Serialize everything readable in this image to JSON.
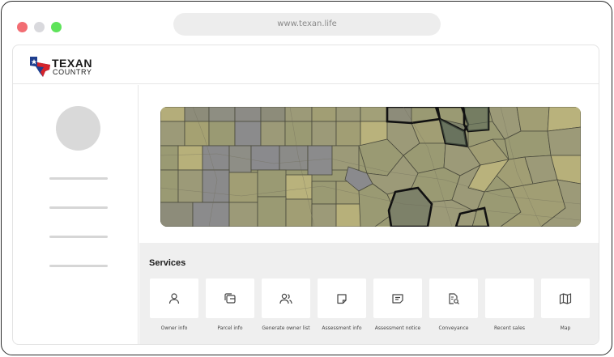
{
  "browser": {
    "url": "www.texan.life",
    "controls": {
      "close_color": "#f26d73",
      "minimize_color": "#d9d9dd",
      "maximize_color": "#5ee35a"
    }
  },
  "brand": {
    "line1": "TEXAN",
    "line2": "COUNTRY",
    "colors": {
      "blue": "#1f3f8f",
      "red": "#d4242b"
    }
  },
  "sidebar": {
    "avatar": "avatar-placeholder",
    "nav_items": 4
  },
  "map": {
    "subject": "county parcel map",
    "accent": "#9a9a73"
  },
  "services": {
    "title": "Services",
    "items": [
      {
        "label": "Owner info",
        "icon": "user-icon"
      },
      {
        "label": "Parcel info",
        "icon": "stacked-pages-icon"
      },
      {
        "label": "Generate owner list",
        "icon": "users-icon"
      },
      {
        "label": "Assessment info",
        "icon": "document-icon"
      },
      {
        "label": "Assessment notice",
        "icon": "notice-icon"
      },
      {
        "label": "Conveyance",
        "icon": "document-search-icon"
      },
      {
        "label": "Recent sales",
        "icon": ""
      },
      {
        "label": "Map",
        "icon": "map-icon"
      }
    ]
  }
}
